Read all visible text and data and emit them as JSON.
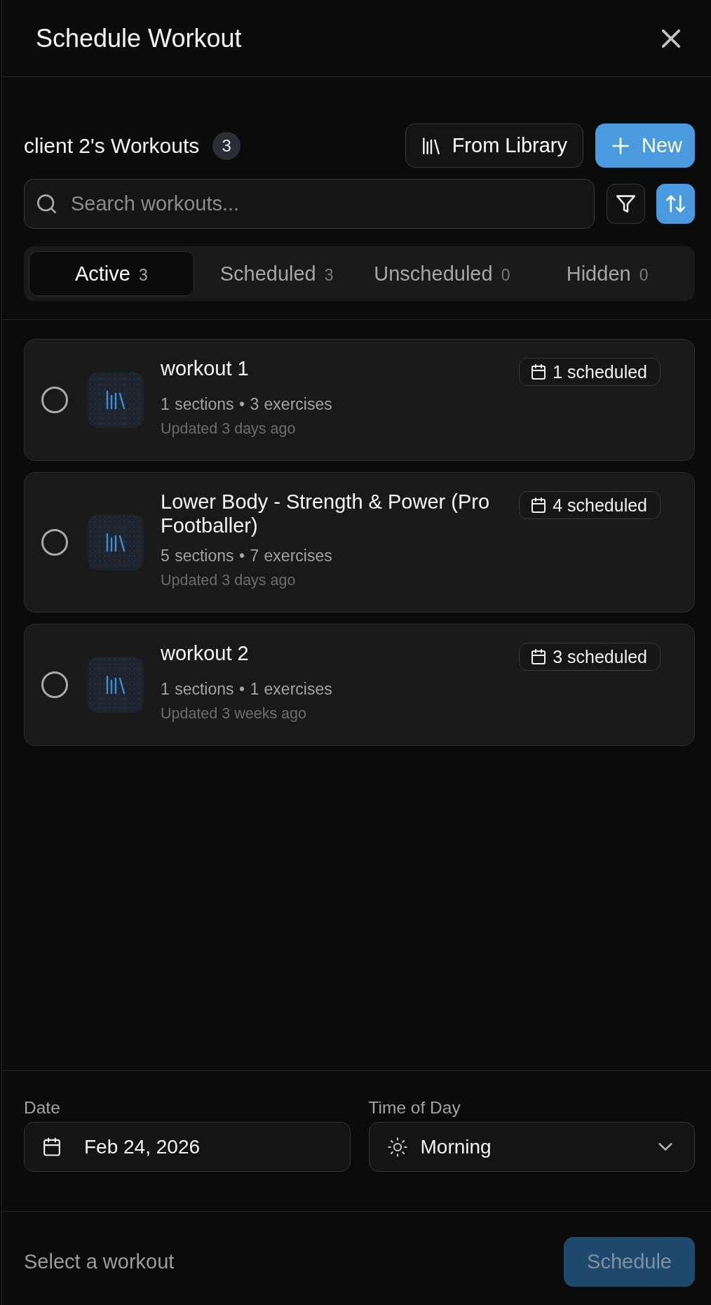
{
  "dialog": {
    "title": "Schedule Workout"
  },
  "workouts_header": {
    "title": "client 2's Workouts",
    "count": "3",
    "buttons": [
      {
        "kind": "library",
        "label": "From Library"
      },
      {
        "kind": "create",
        "label": "New"
      }
    ]
  },
  "search": {
    "placeholder": "Search workouts..."
  },
  "toolbar_buttons": [
    {
      "kind": "filter",
      "on": false
    },
    {
      "kind": "sort",
      "on": true
    }
  ],
  "tabs": [
    {
      "label": "Active",
      "count": "3",
      "selected": true
    },
    {
      "label": "Scheduled",
      "count": "3",
      "selected": false
    },
    {
      "label": "Unscheduled",
      "count": "0",
      "selected": false
    },
    {
      "label": "Hidden",
      "count": "0",
      "selected": false
    }
  ],
  "workouts": [
    {
      "name": "workout 1",
      "selected": false,
      "meta": "1 sections • 3 exercises",
      "updated": "Updated 3 days ago",
      "scheduled": "1 scheduled"
    },
    {
      "name": "Lower Body - Strength & Power (Pro Footballer)",
      "selected": false,
      "meta": "5 sections • 7 exercises",
      "updated": "Updated 3 days ago",
      "scheduled": "4 scheduled"
    },
    {
      "name": "workout 2",
      "selected": false,
      "meta": "1 sections • 1 exercises",
      "updated": "Updated 3 weeks ago",
      "scheduled": "3 scheduled"
    }
  ],
  "date_field": {
    "label": "Date",
    "value": "Feb 24, 2026"
  },
  "time_field": {
    "label": "Time of Day",
    "value": "Morning"
  },
  "footer": {
    "status": "Select a workout",
    "button": {
      "label": "Schedule",
      "disabled": true
    }
  }
}
